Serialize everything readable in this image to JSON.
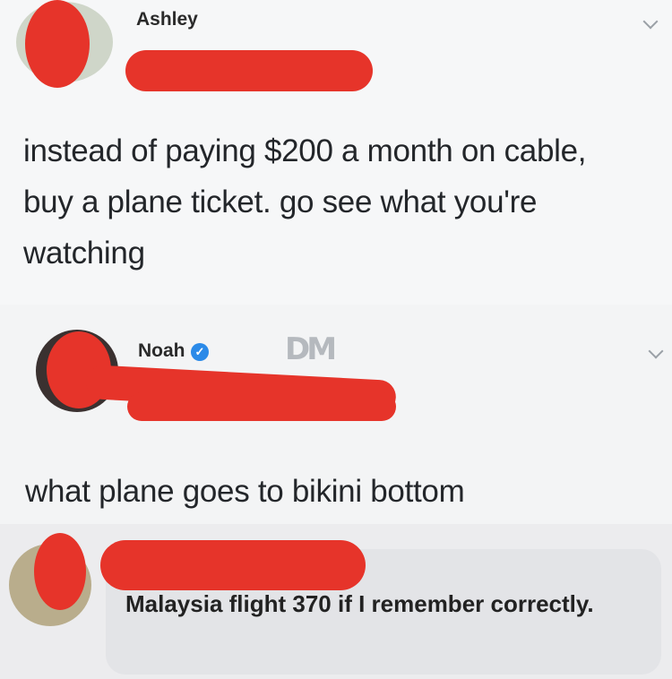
{
  "post_1": {
    "author_name": "Ashley",
    "text": "instead of paying $200 a month on cable, buy a plane ticket. go see what you're watching"
  },
  "post_2": {
    "author_name": "Noah",
    "watermark": "DM",
    "text": "what plane goes to bikini bottom"
  },
  "post_3": {
    "text": "Malaysia flight 370 if I remember correctly."
  },
  "icons": {
    "verified": "verified-badge-icon",
    "menu": "chevron-down-icon"
  },
  "colors": {
    "redaction": "#e6342a",
    "verified": "#2b8ae8"
  }
}
